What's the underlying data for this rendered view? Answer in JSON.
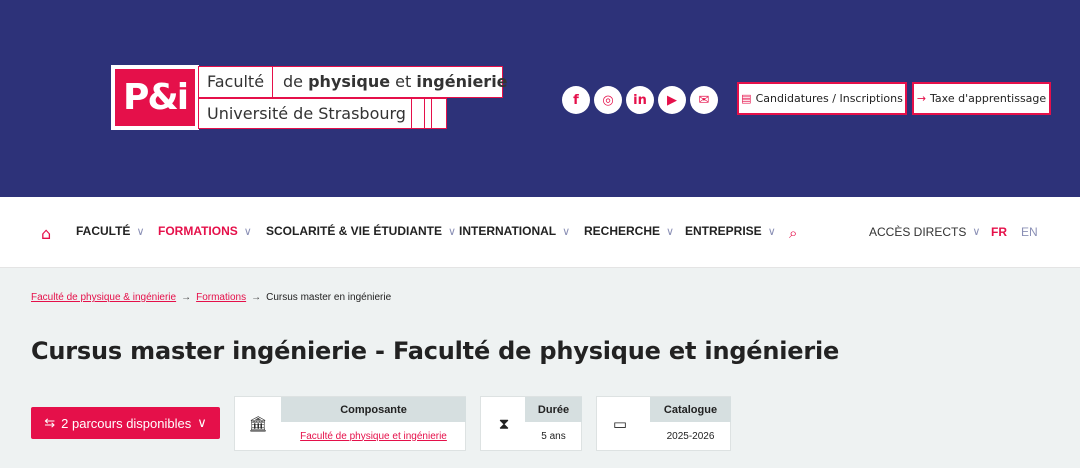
{
  "logo": {
    "mark": "P&i",
    "faculte": "Faculté",
    "de": "de",
    "physique": "physique",
    "et": "et",
    "ingenierie": "ingénierie",
    "universite": "Université de Strasbourg"
  },
  "socials": [
    {
      "glyph": "f",
      "icon": "facebook-icon"
    },
    {
      "glyph": "◎",
      "icon": "instagram-icon"
    },
    {
      "glyph": "in",
      "icon": "linkedin-icon"
    },
    {
      "glyph": "▶",
      "icon": "youtube-icon"
    },
    {
      "glyph": "✉",
      "icon": "podcast-icon"
    }
  ],
  "header": {
    "candidatures": "Candidatures / Inscriptions",
    "taxe": "Taxe d'apprentissage"
  },
  "nav": {
    "faculte": "FACULTÉ",
    "formations": "FORMATIONS",
    "scolarite": "SCOLARITÉ & VIE ÉTUDIANTE",
    "international": "INTERNATIONAL",
    "recherche": "RECHERCHE",
    "entreprise": "ENTREPRISE",
    "acces": "ACCÈS DIRECTS",
    "fr": "FR",
    "en": "EN"
  },
  "breadcrumb": {
    "home": "Faculté de physique & ingénierie",
    "formations": "Formations",
    "current": "Cursus master en ingénierie"
  },
  "page": {
    "title": "Cursus master ingénierie - Faculté de physique et ingénierie"
  },
  "parcours": {
    "label": "2 parcours disponibles"
  },
  "info": {
    "composante_head": "Composante",
    "composante_val": "Faculté de physique et ingénierie",
    "duree_head": "Durée",
    "duree_val": "5 ans",
    "catalogue_head": "Catalogue",
    "catalogue_val": "2025-2026"
  },
  "colors": {
    "header_bg": "#2d3279",
    "accent": "#e5104a",
    "page_bg": "#eef2f2"
  }
}
